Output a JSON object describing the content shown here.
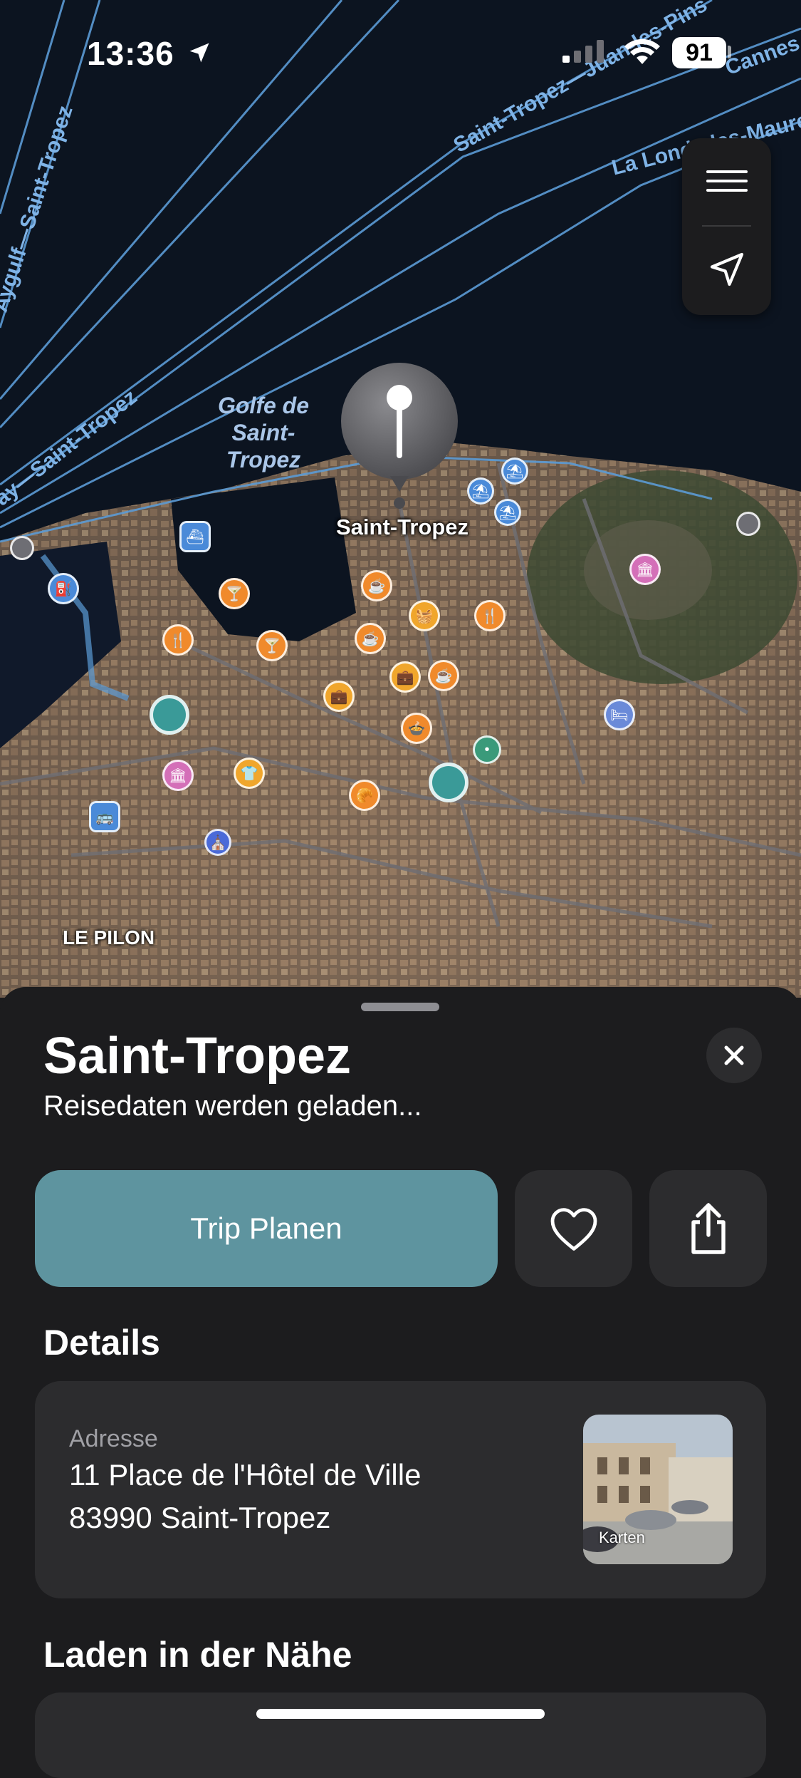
{
  "status_bar": {
    "time": "13:36",
    "battery": "91"
  },
  "map": {
    "route_labels": [
      "Saint-Tropez—Juan-les-Pins",
      "Cannes",
      "La Londe-les-Maures",
      "Aygulf—Saint-Tropez",
      "Bay—Saint-Tropez"
    ],
    "water_label": "Golfe de Saint-Tropez",
    "selected_place_label": "Saint-Tropez",
    "district_label": "LE PILON",
    "colors": {
      "route": "#5b9bd5",
      "food_pin": "#f08a2c",
      "shop_pin": "#f0a62c",
      "culture_pin": "#d46fb8",
      "transit_pin": "#4a8ad8",
      "park_pin": "#3a9a98"
    }
  },
  "controls": {
    "menu_icon": "list-icon",
    "locate_icon": "location-arrow-icon"
  },
  "sheet": {
    "title": "Saint-Tropez",
    "subtitle": "Reisedaten werden geladen...",
    "primary_button": "Trip Planen",
    "favorite_icon": "heart-icon",
    "share_icon": "share-icon",
    "close_icon": "close-icon",
    "details_heading": "Details",
    "address_label": "Adresse",
    "address_line1": "11 Place de l'Hôtel de Ville",
    "address_line2": "83990  Saint-Tropez",
    "thumbnail_tag": "Karten",
    "nearby_heading": "Laden in der Nähe",
    "accent": "#5e949f"
  }
}
